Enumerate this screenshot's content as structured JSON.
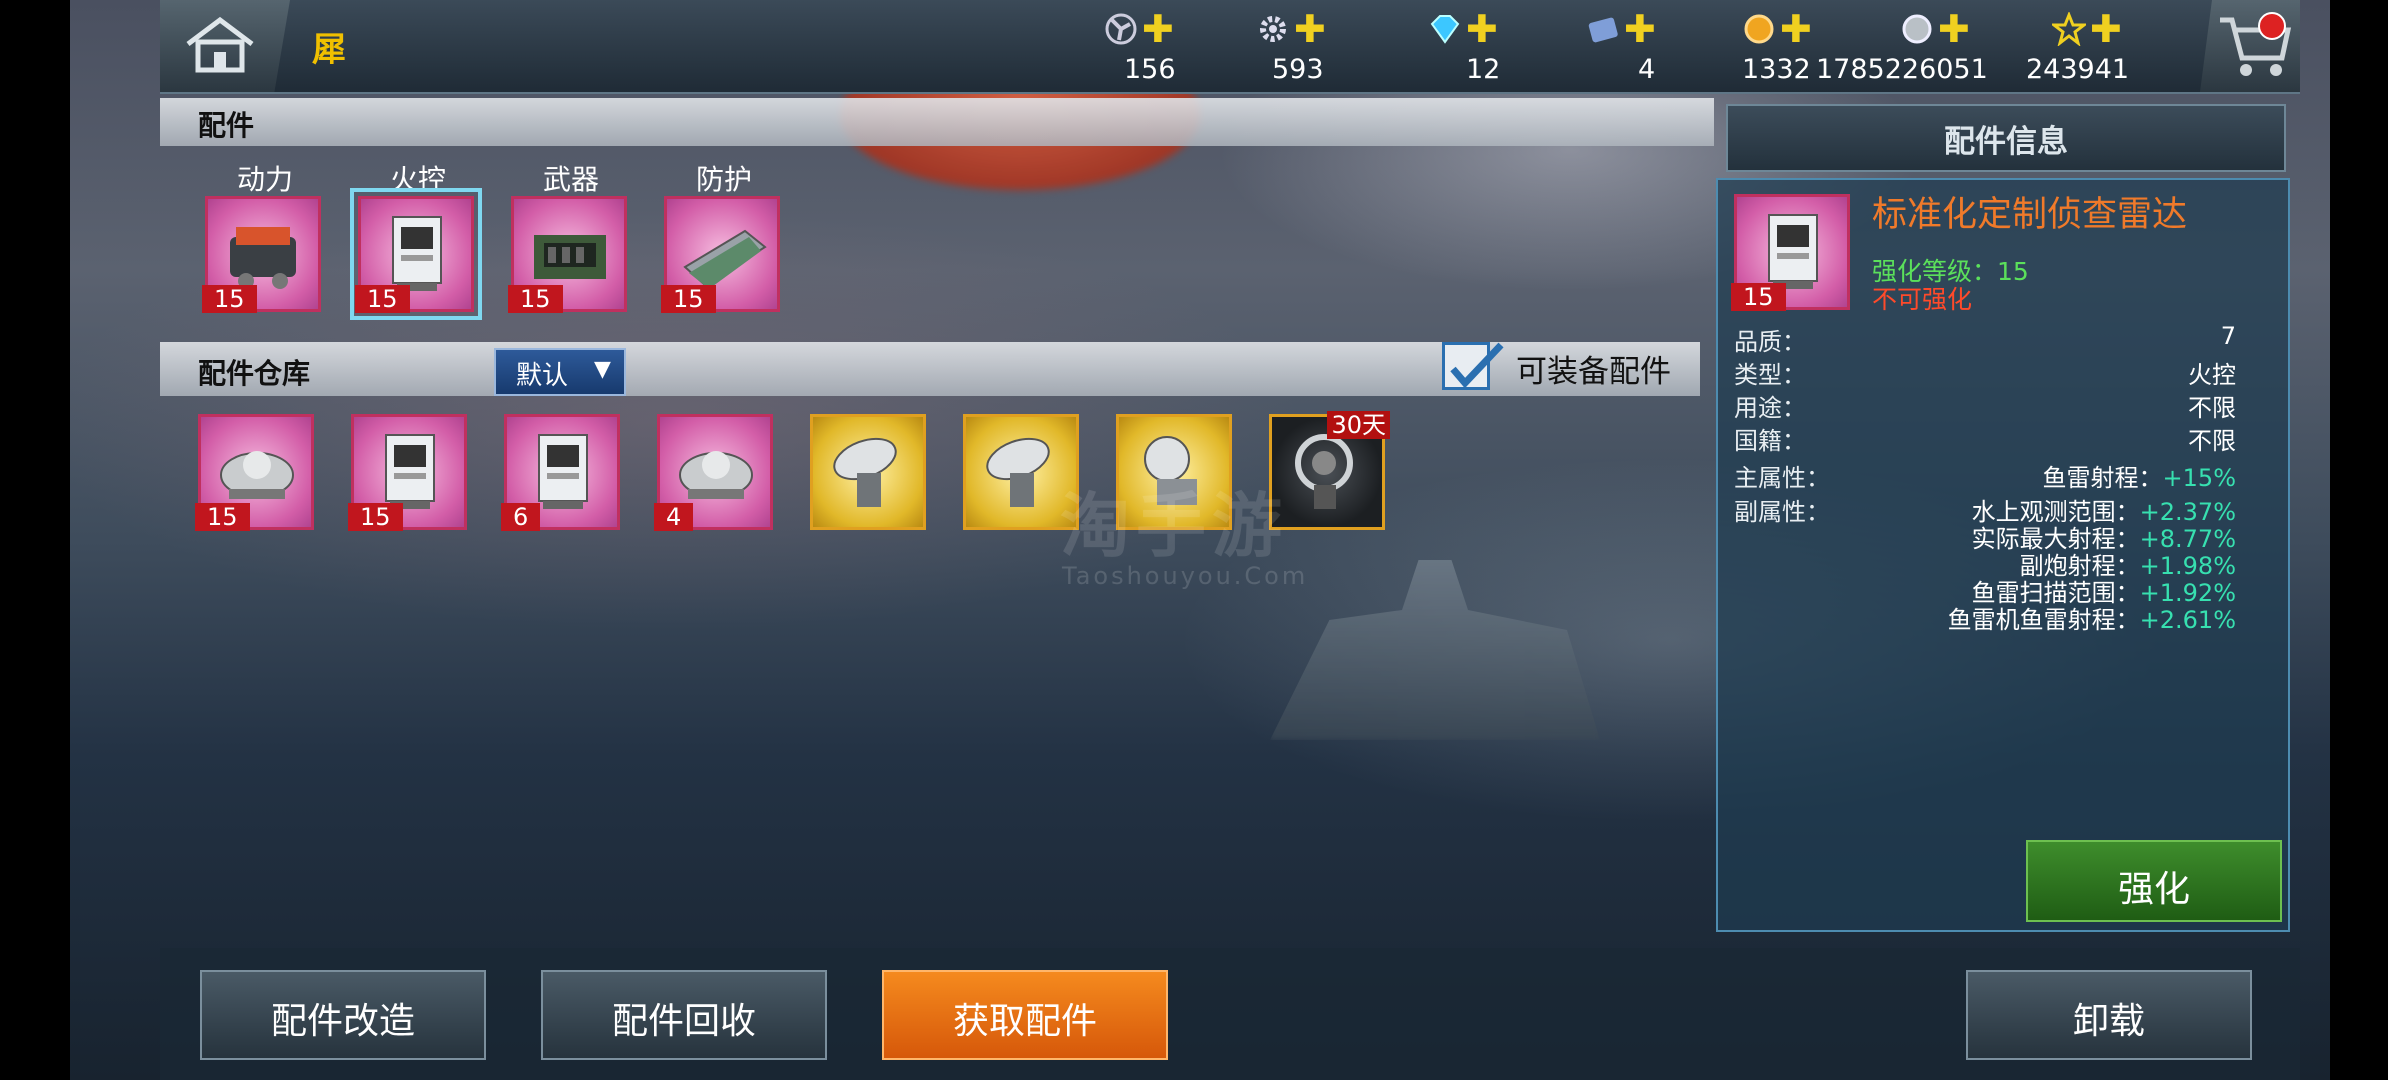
{
  "header": {
    "title": "犀",
    "resources": [
      {
        "icon": "propeller-icon",
        "value": "156"
      },
      {
        "icon": "gear-icon",
        "value": "593"
      },
      {
        "icon": "diamond-icon",
        "value": "12"
      },
      {
        "icon": "ticket-icon",
        "value": "4"
      },
      {
        "icon": "gold-coin-icon",
        "value": "1332"
      },
      {
        "icon": "silver-coin-icon",
        "value": "1785226051"
      },
      {
        "icon": "star-icon",
        "value": "243941"
      }
    ]
  },
  "equipped": {
    "title": "配件",
    "slots": [
      {
        "label": "动力",
        "level": "15",
        "selected": false,
        "kind": "engine"
      },
      {
        "label": "火控",
        "level": "15",
        "selected": true,
        "kind": "radar-cabinet"
      },
      {
        "label": "武器",
        "level": "15",
        "selected": false,
        "kind": "weapon-module"
      },
      {
        "label": "防护",
        "level": "15",
        "selected": false,
        "kind": "armor-plate"
      }
    ]
  },
  "warehouse": {
    "title": "配件仓库",
    "sort_value": "默认",
    "filter_label": "可装备配件",
    "filter_checked": true,
    "items": [
      {
        "rarity": "pink",
        "level": "15",
        "kind": "sonar-dome"
      },
      {
        "rarity": "pink",
        "level": "15",
        "kind": "radar-cabinet"
      },
      {
        "rarity": "pink",
        "level": "6",
        "kind": "radar-cabinet"
      },
      {
        "rarity": "pink",
        "level": "4",
        "kind": "sonar-dome"
      },
      {
        "rarity": "gold",
        "level": "",
        "kind": "radar-dish"
      },
      {
        "rarity": "gold",
        "level": "",
        "kind": "radar-dish"
      },
      {
        "rarity": "gold",
        "level": "",
        "kind": "radar-dish"
      },
      {
        "rarity": "black",
        "level": "",
        "days": "30天",
        "kind": "radar-dish"
      }
    ]
  },
  "info": {
    "title": "配件信息",
    "part_name": "标准化定制侦查雷达",
    "level": "15",
    "enhance_level": "强化等级：15",
    "not_enhanceable": "不可强化",
    "props": [
      {
        "key": "品质：",
        "value": "7"
      },
      {
        "key": "类型：",
        "value": "火控"
      },
      {
        "key": "用途：",
        "value": "不限"
      },
      {
        "key": "国籍：",
        "value": "不限"
      }
    ],
    "main_attr_label": "主属性：",
    "main_attr": {
      "name": "鱼雷射程：",
      "bonus": "+15%"
    },
    "sub_attr_label": "副属性：",
    "sub_attrs": [
      {
        "name": "水上观测范围：",
        "bonus": "+2.37%"
      },
      {
        "name": "实际最大射程：",
        "bonus": "+8.77%"
      },
      {
        "name": "副炮射程：",
        "bonus": "+1.98%"
      },
      {
        "name": "鱼雷扫描范围：",
        "bonus": "+1.92%"
      },
      {
        "name": "鱼雷机鱼雷射程：",
        "bonus": "+2.61%"
      }
    ],
    "enhance_button": "强化"
  },
  "bottom": {
    "modify_button": "配件改造",
    "recycle_button": "配件回收",
    "obtain_button": "获取配件",
    "unload_button": "卸载"
  },
  "watermark": {
    "text": "淘手游",
    "url": "Taoshouyou.Com"
  },
  "colors": {
    "accent_orange": "#f07a2a",
    "enhance_green": "#5be05b",
    "bonus_teal": "#37e0b0",
    "warn_red": "#ff4a2a"
  }
}
